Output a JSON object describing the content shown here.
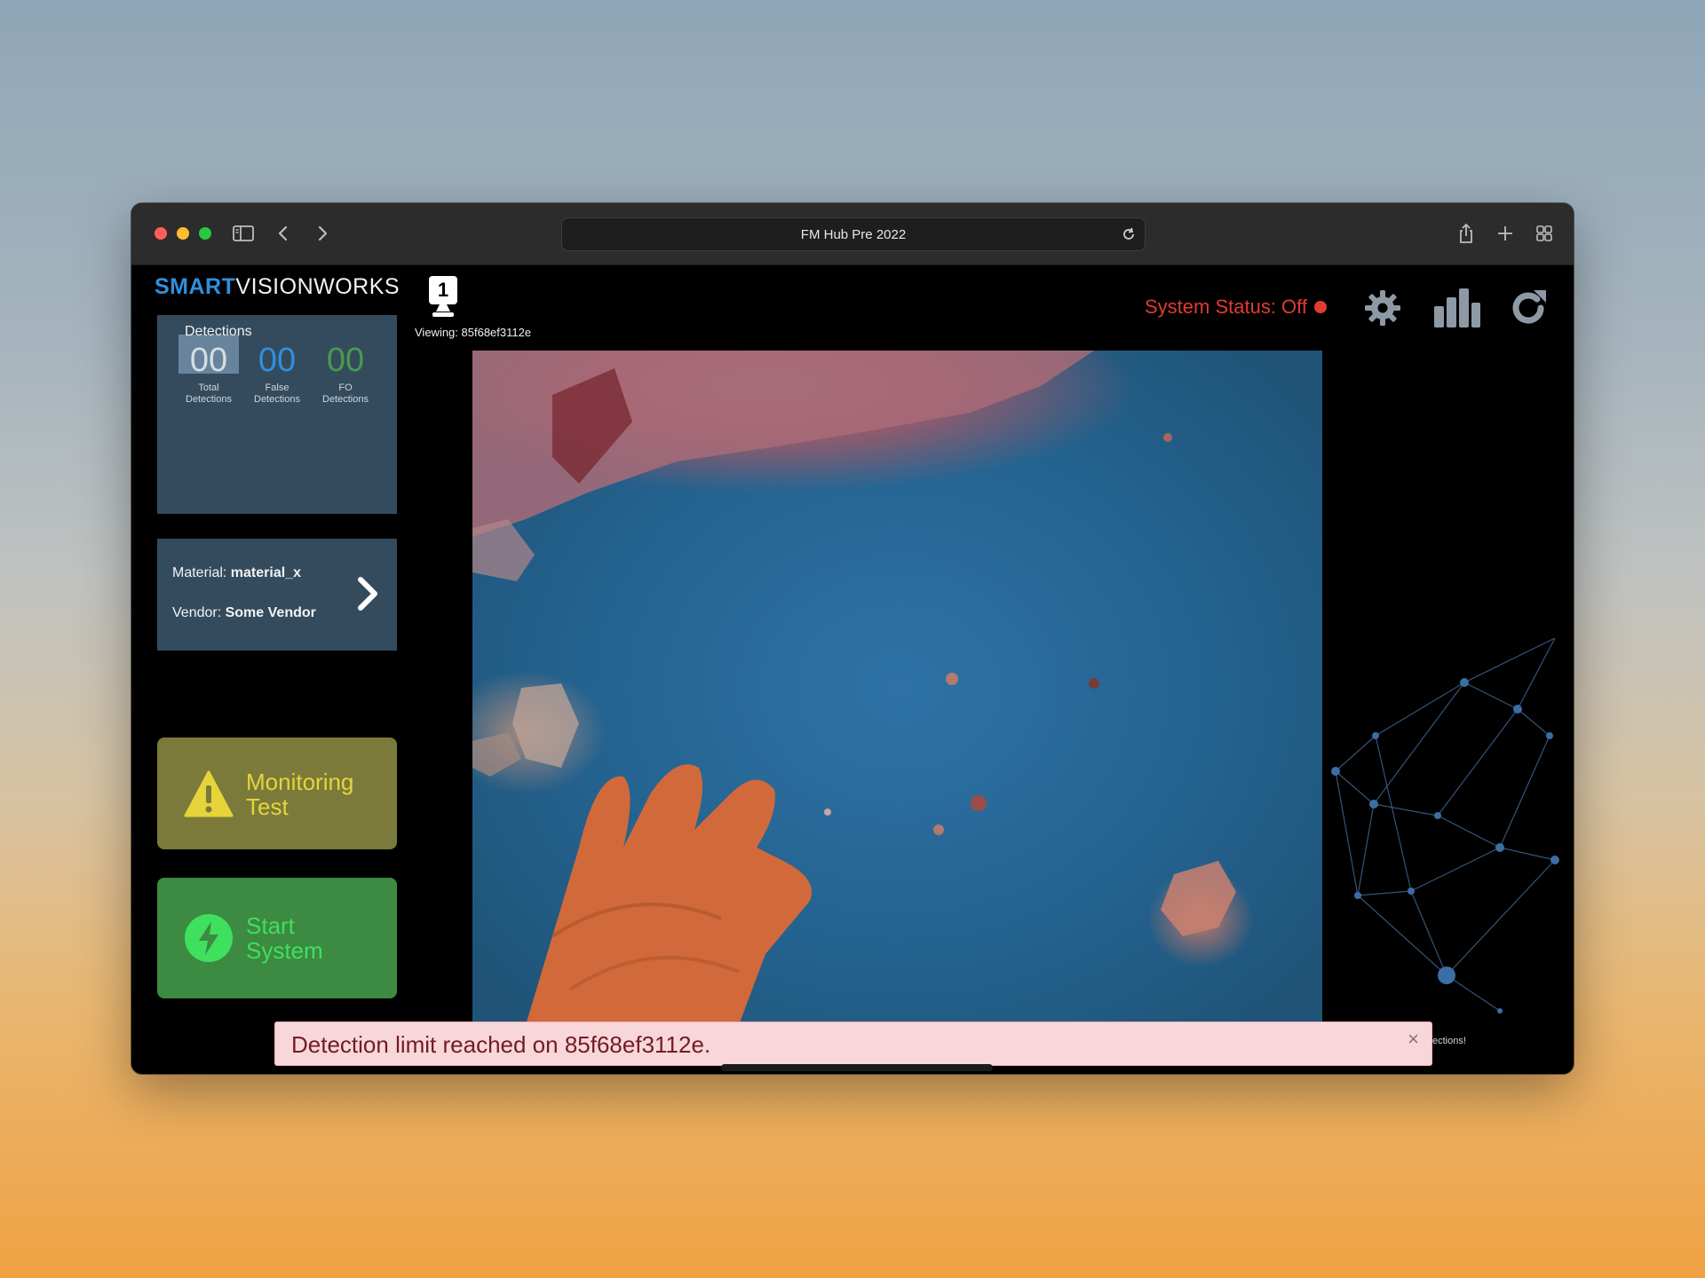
{
  "browser": {
    "url_title": "FM Hub Pre 2022"
  },
  "header": {
    "logo_part1": "SMART",
    "logo_part2": "VISIONWORKS",
    "camera_number": "1",
    "viewing": "Viewing: 85f68ef3112e",
    "status_text": "System Status: Off",
    "status_color": "#e03c31"
  },
  "detections": {
    "title": "Detections",
    "total_value": "00",
    "total_label_1": "Total",
    "total_label_2": "Detections",
    "false_value": "00",
    "false_label_1": "False",
    "false_label_2": "Detections",
    "fo_value": "00",
    "fo_label_1": "FO",
    "fo_label_2": "Detections"
  },
  "material": {
    "material_label": "Material: ",
    "material_value": "material_x",
    "vendor_label": "Vendor: ",
    "vendor_value": "Some Vendor"
  },
  "actions": {
    "monitor_line1": "Monitoring",
    "monitor_line2": "Test",
    "start_line1": "Start",
    "start_line2": "System"
  },
  "alert": {
    "message": "Detection limit reached on 85f68ef3112e.",
    "close": "×",
    "background_fragment": "ections!"
  },
  "icons": {
    "settings": "gear-icon",
    "stats": "bar-chart-icon",
    "refresh": "refresh-icon",
    "camera": "camera-icon",
    "monitor": "warning-icon",
    "start": "lightning-icon"
  }
}
